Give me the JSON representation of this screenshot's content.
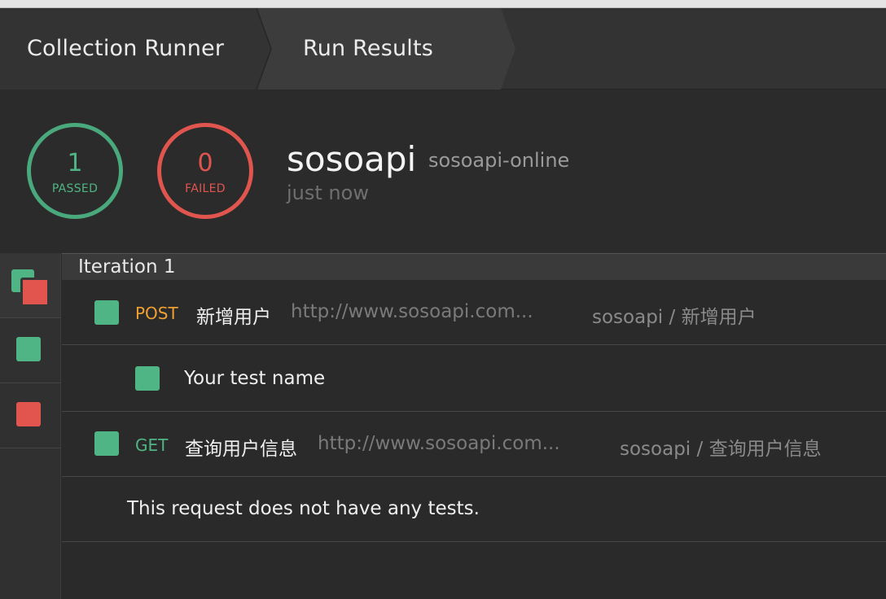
{
  "tabs": [
    {
      "label": "Collection Runner"
    },
    {
      "label": "Run Results"
    }
  ],
  "summary": {
    "passed_count": "1",
    "passed_label": "PASSED",
    "failed_count": "0",
    "failed_label": "FAILED",
    "collection_name": "sosoapi",
    "environment": "sosoapi-online",
    "time": "just now"
  },
  "iteration": {
    "label": "Iteration 1"
  },
  "requests": [
    {
      "method": "POST",
      "name": "新增用户",
      "url": "http://www.sosoapi.com...",
      "path": "sosoapi / 新增用户",
      "status": "passed",
      "tests": [
        {
          "name": "Your test name",
          "status": "passed"
        }
      ]
    },
    {
      "method": "GET",
      "name": "查询用户信息",
      "url": "http://www.sosoapi.com...",
      "path": "sosoapi / 查询用户信息",
      "status": "passed",
      "no_tests_message": "This request does not have any tests."
    }
  ],
  "sidebar": [
    {
      "name": "all",
      "icon": "all-results-icon",
      "active": true
    },
    {
      "name": "passed",
      "icon": "passed-filter-icon",
      "active": false
    },
    {
      "name": "failed",
      "icon": "failed-filter-icon",
      "active": false
    }
  ],
  "colors": {
    "pass": "#4fb584",
    "fail": "#e2554e",
    "post": "#f0a033",
    "get": "#4fb584",
    "background": "#2a2a2a"
  }
}
